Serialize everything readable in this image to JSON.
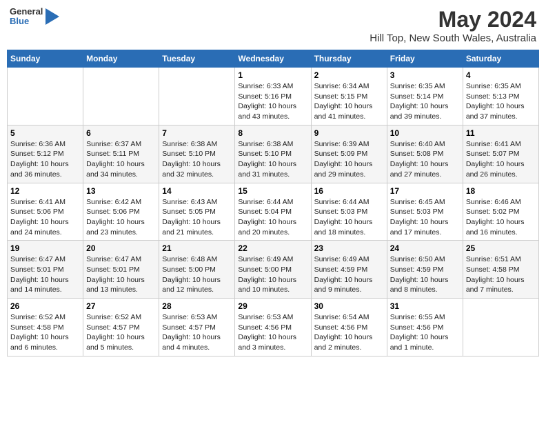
{
  "logo": {
    "line1": "General",
    "line2": "Blue"
  },
  "title": "May 2024",
  "subtitle": "Hill Top, New South Wales, Australia",
  "weekdays": [
    "Sunday",
    "Monday",
    "Tuesday",
    "Wednesday",
    "Thursday",
    "Friday",
    "Saturday"
  ],
  "weeks": [
    [
      {
        "day": "",
        "info": ""
      },
      {
        "day": "",
        "info": ""
      },
      {
        "day": "",
        "info": ""
      },
      {
        "day": "1",
        "info": "Sunrise: 6:33 AM\nSunset: 5:16 PM\nDaylight: 10 hours\nand 43 minutes."
      },
      {
        "day": "2",
        "info": "Sunrise: 6:34 AM\nSunset: 5:15 PM\nDaylight: 10 hours\nand 41 minutes."
      },
      {
        "day": "3",
        "info": "Sunrise: 6:35 AM\nSunset: 5:14 PM\nDaylight: 10 hours\nand 39 minutes."
      },
      {
        "day": "4",
        "info": "Sunrise: 6:35 AM\nSunset: 5:13 PM\nDaylight: 10 hours\nand 37 minutes."
      }
    ],
    [
      {
        "day": "5",
        "info": "Sunrise: 6:36 AM\nSunset: 5:12 PM\nDaylight: 10 hours\nand 36 minutes."
      },
      {
        "day": "6",
        "info": "Sunrise: 6:37 AM\nSunset: 5:11 PM\nDaylight: 10 hours\nand 34 minutes."
      },
      {
        "day": "7",
        "info": "Sunrise: 6:38 AM\nSunset: 5:10 PM\nDaylight: 10 hours\nand 32 minutes."
      },
      {
        "day": "8",
        "info": "Sunrise: 6:38 AM\nSunset: 5:10 PM\nDaylight: 10 hours\nand 31 minutes."
      },
      {
        "day": "9",
        "info": "Sunrise: 6:39 AM\nSunset: 5:09 PM\nDaylight: 10 hours\nand 29 minutes."
      },
      {
        "day": "10",
        "info": "Sunrise: 6:40 AM\nSunset: 5:08 PM\nDaylight: 10 hours\nand 27 minutes."
      },
      {
        "day": "11",
        "info": "Sunrise: 6:41 AM\nSunset: 5:07 PM\nDaylight: 10 hours\nand 26 minutes."
      }
    ],
    [
      {
        "day": "12",
        "info": "Sunrise: 6:41 AM\nSunset: 5:06 PM\nDaylight: 10 hours\nand 24 minutes."
      },
      {
        "day": "13",
        "info": "Sunrise: 6:42 AM\nSunset: 5:06 PM\nDaylight: 10 hours\nand 23 minutes."
      },
      {
        "day": "14",
        "info": "Sunrise: 6:43 AM\nSunset: 5:05 PM\nDaylight: 10 hours\nand 21 minutes."
      },
      {
        "day": "15",
        "info": "Sunrise: 6:44 AM\nSunset: 5:04 PM\nDaylight: 10 hours\nand 20 minutes."
      },
      {
        "day": "16",
        "info": "Sunrise: 6:44 AM\nSunset: 5:03 PM\nDaylight: 10 hours\nand 18 minutes."
      },
      {
        "day": "17",
        "info": "Sunrise: 6:45 AM\nSunset: 5:03 PM\nDaylight: 10 hours\nand 17 minutes."
      },
      {
        "day": "18",
        "info": "Sunrise: 6:46 AM\nSunset: 5:02 PM\nDaylight: 10 hours\nand 16 minutes."
      }
    ],
    [
      {
        "day": "19",
        "info": "Sunrise: 6:47 AM\nSunset: 5:01 PM\nDaylight: 10 hours\nand 14 minutes."
      },
      {
        "day": "20",
        "info": "Sunrise: 6:47 AM\nSunset: 5:01 PM\nDaylight: 10 hours\nand 13 minutes."
      },
      {
        "day": "21",
        "info": "Sunrise: 6:48 AM\nSunset: 5:00 PM\nDaylight: 10 hours\nand 12 minutes."
      },
      {
        "day": "22",
        "info": "Sunrise: 6:49 AM\nSunset: 5:00 PM\nDaylight: 10 hours\nand 10 minutes."
      },
      {
        "day": "23",
        "info": "Sunrise: 6:49 AM\nSunset: 4:59 PM\nDaylight: 10 hours\nand 9 minutes."
      },
      {
        "day": "24",
        "info": "Sunrise: 6:50 AM\nSunset: 4:59 PM\nDaylight: 10 hours\nand 8 minutes."
      },
      {
        "day": "25",
        "info": "Sunrise: 6:51 AM\nSunset: 4:58 PM\nDaylight: 10 hours\nand 7 minutes."
      }
    ],
    [
      {
        "day": "26",
        "info": "Sunrise: 6:52 AM\nSunset: 4:58 PM\nDaylight: 10 hours\nand 6 minutes."
      },
      {
        "day": "27",
        "info": "Sunrise: 6:52 AM\nSunset: 4:57 PM\nDaylight: 10 hours\nand 5 minutes."
      },
      {
        "day": "28",
        "info": "Sunrise: 6:53 AM\nSunset: 4:57 PM\nDaylight: 10 hours\nand 4 minutes."
      },
      {
        "day": "29",
        "info": "Sunrise: 6:53 AM\nSunset: 4:56 PM\nDaylight: 10 hours\nand 3 minutes."
      },
      {
        "day": "30",
        "info": "Sunrise: 6:54 AM\nSunset: 4:56 PM\nDaylight: 10 hours\nand 2 minutes."
      },
      {
        "day": "31",
        "info": "Sunrise: 6:55 AM\nSunset: 4:56 PM\nDaylight: 10 hours\nand 1 minute."
      },
      {
        "day": "",
        "info": ""
      }
    ]
  ]
}
